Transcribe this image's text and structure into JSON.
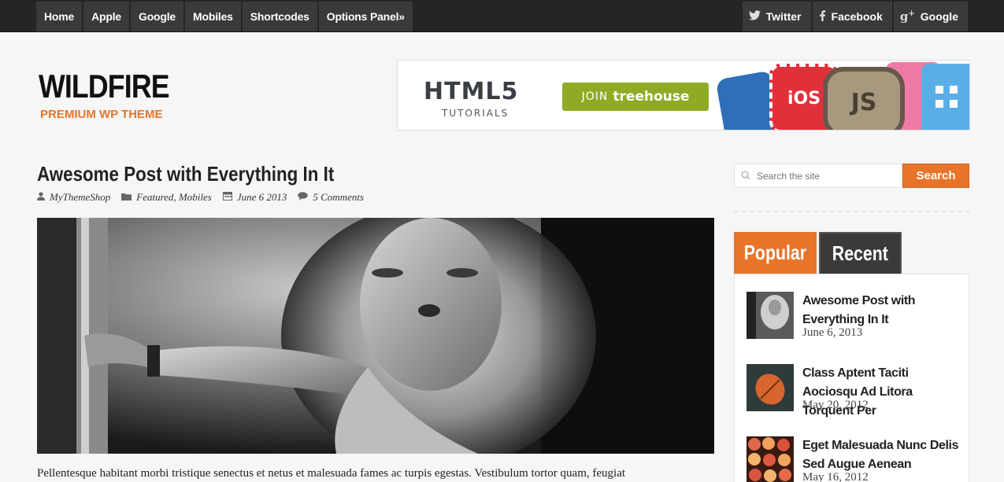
{
  "nav": {
    "items": [
      "Home",
      "Apple",
      "Google",
      "Mobiles",
      "Shortcodes",
      "Options Panel»"
    ]
  },
  "social": {
    "twitter": "Twitter",
    "facebook": "Facebook",
    "google": "Google"
  },
  "logo": {
    "title": "WILDFIRE",
    "tagline": "PREMIUM WP THEME"
  },
  "banner": {
    "headline": "HTML5",
    "subline": "TUTORIALS",
    "cta_prefix": "JOIN",
    "cta_brand": "treehouse",
    "badges": [
      "iOS",
      "JS"
    ]
  },
  "post": {
    "title": "Awesome Post with Everything In It",
    "author": "MyThemeShop",
    "categories": "Featured, Mobiles",
    "date": "June 6 2013",
    "comments": "5 Comments",
    "excerpt": "Pellentesque habitant morbi tristique senectus et netus et malesuada fames ac turpis egestas. Vestibulum tortor quam, feugiat"
  },
  "sidebar": {
    "search_placeholder": "Search the site",
    "search_button": "Search",
    "tabs": {
      "popular": "Popular",
      "recent": "Recent"
    },
    "posts": [
      {
        "title": "Awesome Post with Everything In It",
        "date": "June 6, 2013"
      },
      {
        "title": "Class Aptent Taciti Aociosqu Ad Litora Torquent Per",
        "date": "May 20, 2012"
      },
      {
        "title": "Eget Malesuada Nunc Delis Sed Augue Aenean",
        "date": "May 16, 2012"
      }
    ]
  },
  "colors": {
    "accent": "#e8742a",
    "nav_bg": "#3a3a3a",
    "topbar_bg": "#252525",
    "treehouse_green": "#8fab26"
  }
}
